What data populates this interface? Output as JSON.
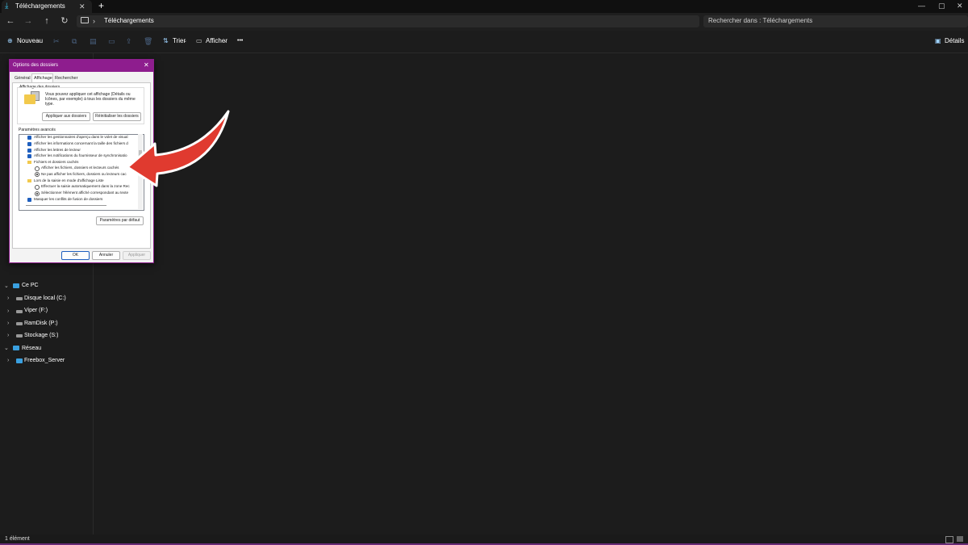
{
  "tab": {
    "title": "Téléchargements",
    "close": "✕",
    "new_tab": "+",
    "icon": "download-icon"
  },
  "window_controls": {
    "minimize": "—",
    "maximize": "▢",
    "close": "✕"
  },
  "nav": {
    "back": "←",
    "forward": "→",
    "up": "↑",
    "refresh": "↻"
  },
  "address": {
    "separator": "›",
    "path": "Téléchargements"
  },
  "search": {
    "placeholder": "Rechercher dans : Téléchargements"
  },
  "commands": {
    "new": "Nouveau",
    "sort": "Trier",
    "view": "Afficher",
    "more": "•••",
    "details": "Détails"
  },
  "sidebar": {
    "this_pc": "Ce PC",
    "drives": [
      {
        "label": "Disque local (C:)"
      },
      {
        "label": "Viper (F:)"
      },
      {
        "label": "RamDisk (P:)"
      },
      {
        "label": "Stockage (S:)"
      }
    ],
    "network": "Réseau",
    "network_items": [
      {
        "label": "Freebox_Server"
      }
    ]
  },
  "status": {
    "count": "1 élément"
  },
  "dialog": {
    "title": "Options des dossiers",
    "close": "✕",
    "tabs": [
      "Général",
      "Affichage",
      "Rechercher"
    ],
    "selected_tab": "Affichage",
    "folder_views": {
      "heading": "Affichage des dossiers",
      "description_1": "Vous pouvez appliquer cet affichage (Détails ou",
      "description_2": "Icônes, par exemple) à tous les dossiers du même",
      "description_3": "type.",
      "apply_button": "Appliquer aux dossiers",
      "reset_button": "Réinitialiser les dossiers"
    },
    "advanced": {
      "heading": "Paramètres avancés",
      "items": [
        {
          "kind": "check",
          "label": "Afficher les gestionnaires d'aperçu dans le volet de visual"
        },
        {
          "kind": "check",
          "label": "Afficher les informations concernant la taille des fichiers d"
        },
        {
          "kind": "check",
          "label": "Afficher les lettres de lecteur"
        },
        {
          "kind": "check",
          "label": "Afficher les notifications du fournisseur de synchronisatio"
        },
        {
          "kind": "folder",
          "label": "Fichiers et dossiers cachés"
        },
        {
          "kind": "radio",
          "label": "Afficher les fichiers, dossiers et lecteurs cachés"
        },
        {
          "kind": "radio_on",
          "label": "Ne pas afficher les fichiers, dossiers ou lecteurs cac"
        },
        {
          "kind": "folder",
          "label": "Lors de la saisie en mode d'affichage Liste"
        },
        {
          "kind": "radio",
          "label": "Effectuer la saisie automatiquement dans la zone Rec"
        },
        {
          "kind": "radio_on",
          "label": "Sélectionner l'élément affiché correspondant au texte"
        },
        {
          "kind": "check",
          "label": "Masquer les conflits de fusion de dossiers"
        }
      ],
      "defaults_button": "Paramètres par défaut"
    },
    "ok": "OK",
    "cancel": "Annuler",
    "apply": "Appliquer"
  },
  "colors": {
    "dialog_title_bar": "#8e1d8e",
    "annotation_arrow": "#e03a2f",
    "checkbox": "#1f5fbf"
  }
}
